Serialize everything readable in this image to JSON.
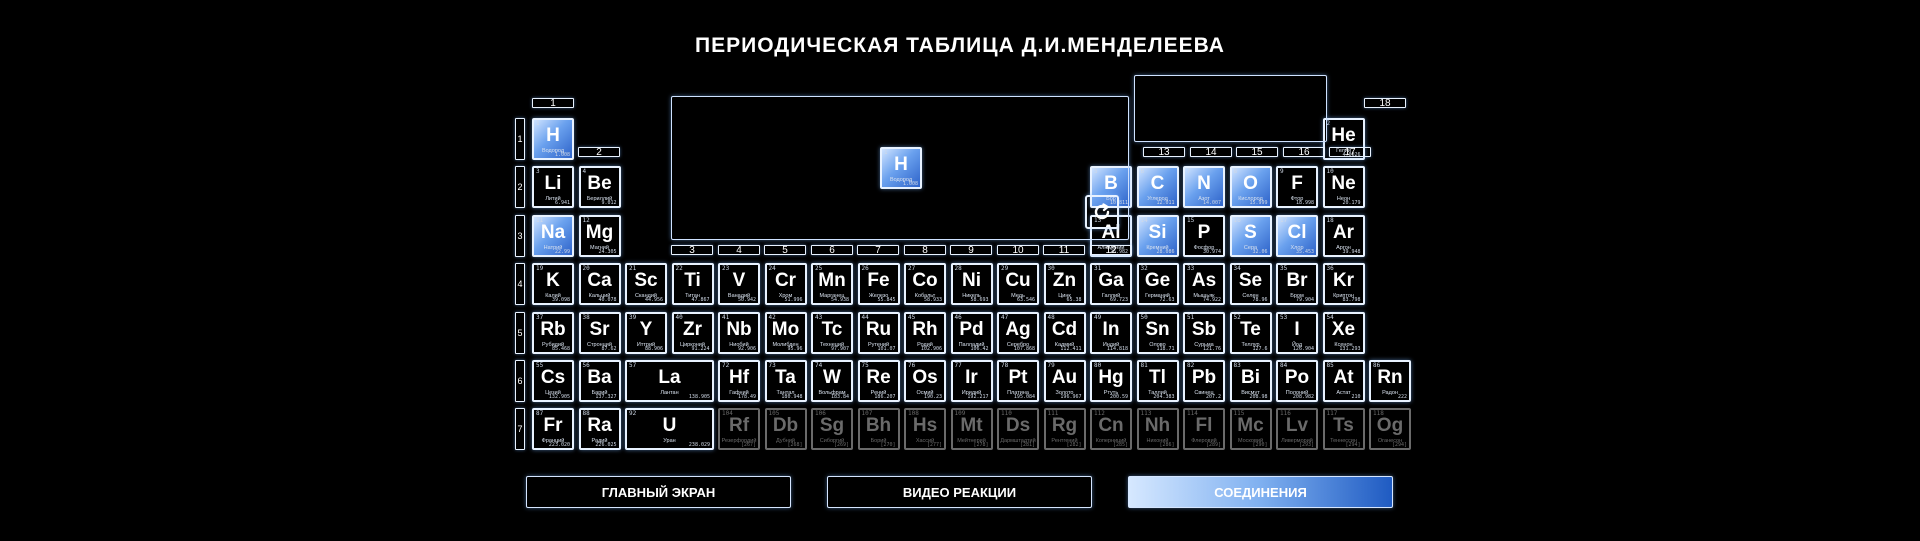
{
  "title": "ПЕРИОДИЧЕСКАЯ ТАБЛИЦА Д.И.МЕНДЕЛЕЕВА",
  "groups": [
    "1",
    "2",
    "3",
    "4",
    "5",
    "6",
    "7",
    "8",
    "9",
    "10",
    "11",
    "12",
    "13",
    "14",
    "15",
    "16",
    "17",
    "18"
  ],
  "periods": [
    "1",
    "2",
    "3",
    "4",
    "5",
    "6",
    "7"
  ],
  "selected": {
    "symbol": "H",
    "name": "Водород",
    "number": "1",
    "mass": "1.008"
  },
  "buttons": {
    "home": "ГЛАВНЫЙ ЭКРАН",
    "video": "ВИДЕО РЕАКЦИИ",
    "compounds": "СОЕДИНЕНИЯ"
  },
  "colors": {
    "accent": "#2e63c9",
    "highlight": "#6aa1ee",
    "border": "#e8f2ff",
    "dim": "#6a6a6a"
  },
  "icons": {
    "reload": "reload-icon"
  },
  "elements": [
    {
      "n": "1",
      "s": "H",
      "name": "Водород",
      "m": "1.008",
      "p": 1,
      "g": 1,
      "hl": true
    },
    {
      "n": "2",
      "s": "He",
      "name": "Гелий",
      "m": "4.0026",
      "p": 1,
      "g": 18
    },
    {
      "n": "3",
      "s": "Li",
      "name": "Литий",
      "m": "6.941",
      "p": 2,
      "g": 1
    },
    {
      "n": "4",
      "s": "Be",
      "name": "Бериллий",
      "m": "9.012",
      "p": 2,
      "g": 2
    },
    {
      "n": "5",
      "s": "B",
      "name": "Бор",
      "m": "10.811",
      "p": 2,
      "g": 13,
      "hl": true
    },
    {
      "n": "6",
      "s": "C",
      "name": "Углерод",
      "m": "12.011",
      "p": 2,
      "g": 14,
      "hl": true
    },
    {
      "n": "7",
      "s": "N",
      "name": "Азот",
      "m": "14.007",
      "p": 2,
      "g": 15,
      "hl": true
    },
    {
      "n": "8",
      "s": "O",
      "name": "Кислород",
      "m": "15.999",
      "p": 2,
      "g": 16,
      "hl": true
    },
    {
      "n": "9",
      "s": "F",
      "name": "Фтор",
      "m": "18.998",
      "p": 2,
      "g": 17
    },
    {
      "n": "10",
      "s": "Ne",
      "name": "Неон",
      "m": "20.179",
      "p": 2,
      "g": 18
    },
    {
      "n": "11",
      "s": "Na",
      "name": "Натрий",
      "m": "22.99",
      "p": 3,
      "g": 1,
      "hl": true
    },
    {
      "n": "12",
      "s": "Mg",
      "name": "Магний",
      "m": "24.305",
      "p": 3,
      "g": 2
    },
    {
      "n": "13",
      "s": "Al",
      "name": "Алюминий",
      "m": "26.982",
      "p": 3,
      "g": 13
    },
    {
      "n": "14",
      "s": "Si",
      "name": "Кремний",
      "m": "28.086",
      "p": 3,
      "g": 14,
      "hl": true
    },
    {
      "n": "15",
      "s": "P",
      "name": "Фосфор",
      "m": "30.974",
      "p": 3,
      "g": 15
    },
    {
      "n": "16",
      "s": "S",
      "name": "Сера",
      "m": "32.06",
      "p": 3,
      "g": 16,
      "hl": true
    },
    {
      "n": "17",
      "s": "Cl",
      "name": "Хлор",
      "m": "35.453",
      "p": 3,
      "g": 17,
      "hl": true
    },
    {
      "n": "18",
      "s": "Ar",
      "name": "Аргон",
      "m": "39.948",
      "p": 3,
      "g": 18
    },
    {
      "n": "19",
      "s": "K",
      "name": "Калий",
      "m": "39.098",
      "p": 4,
      "g": 1
    },
    {
      "n": "20",
      "s": "Ca",
      "name": "Кальций",
      "m": "40.078",
      "p": 4,
      "g": 2
    },
    {
      "n": "21",
      "s": "Sc",
      "name": "Скандий",
      "m": "44.956",
      "p": 4,
      "g": 3
    },
    {
      "n": "22",
      "s": "Ti",
      "name": "Титан",
      "m": "47.867",
      "p": 4,
      "g": 4
    },
    {
      "n": "23",
      "s": "V",
      "name": "Ванадий",
      "m": "50.942",
      "p": 4,
      "g": 5
    },
    {
      "n": "24",
      "s": "Cr",
      "name": "Хром",
      "m": "51.996",
      "p": 4,
      "g": 6
    },
    {
      "n": "25",
      "s": "Mn",
      "name": "Марганец",
      "m": "54.938",
      "p": 4,
      "g": 7
    },
    {
      "n": "26",
      "s": "Fe",
      "name": "Железо",
      "m": "55.845",
      "p": 4,
      "g": 8
    },
    {
      "n": "27",
      "s": "Co",
      "name": "Кобальт",
      "m": "58.933",
      "p": 4,
      "g": 9
    },
    {
      "n": "28",
      "s": "Ni",
      "name": "Никель",
      "m": "58.693",
      "p": 4,
      "g": 10
    },
    {
      "n": "29",
      "s": "Cu",
      "name": "Медь",
      "m": "63.546",
      "p": 4,
      "g": 11
    },
    {
      "n": "30",
      "s": "Zn",
      "name": "Цинк",
      "m": "65.38",
      "p": 4,
      "g": 12
    },
    {
      "n": "31",
      "s": "Ga",
      "name": "Галлий",
      "m": "69.723",
      "p": 4,
      "g": 13
    },
    {
      "n": "32",
      "s": "Ge",
      "name": "Германий",
      "m": "72.63",
      "p": 4,
      "g": 14
    },
    {
      "n": "33",
      "s": "As",
      "name": "Мышьяк",
      "m": "74.922",
      "p": 4,
      "g": 15
    },
    {
      "n": "34",
      "s": "Se",
      "name": "Селен",
      "m": "78.96",
      "p": 4,
      "g": 16
    },
    {
      "n": "35",
      "s": "Br",
      "name": "Бром",
      "m": "79.904",
      "p": 4,
      "g": 17
    },
    {
      "n": "36",
      "s": "Kr",
      "name": "Криптон",
      "m": "83.798",
      "p": 4,
      "g": 18
    },
    {
      "n": "37",
      "s": "Rb",
      "name": "Рубидий",
      "m": "85.468",
      "p": 5,
      "g": 1
    },
    {
      "n": "38",
      "s": "Sr",
      "name": "Стронций",
      "m": "87.62",
      "p": 5,
      "g": 2
    },
    {
      "n": "39",
      "s": "Y",
      "name": "Иттрий",
      "m": "88.906",
      "p": 5,
      "g": 3
    },
    {
      "n": "40",
      "s": "Zr",
      "name": "Цирконий",
      "m": "91.224",
      "p": 5,
      "g": 4
    },
    {
      "n": "41",
      "s": "Nb",
      "name": "Ниобий",
      "m": "92.906",
      "p": 5,
      "g": 5
    },
    {
      "n": "42",
      "s": "Mo",
      "name": "Молибден",
      "m": "95.96",
      "p": 5,
      "g": 6
    },
    {
      "n": "43",
      "s": "Tc",
      "name": "Технеций",
      "m": "97.907",
      "p": 5,
      "g": 7
    },
    {
      "n": "44",
      "s": "Ru",
      "name": "Рутений",
      "m": "101.07",
      "p": 5,
      "g": 8
    },
    {
      "n": "45",
      "s": "Rh",
      "name": "Родий",
      "m": "102.906",
      "p": 5,
      "g": 9
    },
    {
      "n": "46",
      "s": "Pd",
      "name": "Палладий",
      "m": "106.42",
      "p": 5,
      "g": 10
    },
    {
      "n": "47",
      "s": "Ag",
      "name": "Серебро",
      "m": "107.868",
      "p": 5,
      "g": 11
    },
    {
      "n": "48",
      "s": "Cd",
      "name": "Кадмий",
      "m": "112.411",
      "p": 5,
      "g": 12
    },
    {
      "n": "49",
      "s": "In",
      "name": "Индий",
      "m": "114.818",
      "p": 5,
      "g": 13
    },
    {
      "n": "50",
      "s": "Sn",
      "name": "Олово",
      "m": "118.71",
      "p": 5,
      "g": 14
    },
    {
      "n": "51",
      "s": "Sb",
      "name": "Сурьма",
      "m": "121.76",
      "p": 5,
      "g": 15
    },
    {
      "n": "52",
      "s": "Te",
      "name": "Теллур",
      "m": "127.6",
      "p": 5,
      "g": 16
    },
    {
      "n": "53",
      "s": "I",
      "name": "Йод",
      "m": "126.904",
      "p": 5,
      "g": 17
    },
    {
      "n": "54",
      "s": "Xe",
      "name": "Ксенон",
      "m": "131.293",
      "p": 5,
      "g": 18
    },
    {
      "n": "55",
      "s": "Cs",
      "name": "Цезий",
      "m": "132.905",
      "p": 6,
      "g": 1
    },
    {
      "n": "56",
      "s": "Ba",
      "name": "Барий",
      "m": "137.327",
      "p": 6,
      "g": 2
    },
    {
      "n": "57",
      "s": "La",
      "name": "Лантан",
      "m": "138.905",
      "p": 6,
      "g": 3,
      "wide": true
    },
    {
      "n": "72",
      "s": "Hf",
      "name": "Гафний",
      "m": "178.49",
      "p": 6,
      "g": 5
    },
    {
      "n": "73",
      "s": "Ta",
      "name": "Тантал",
      "m": "180.948",
      "p": 6,
      "g": 6
    },
    {
      "n": "74",
      "s": "W",
      "name": "Вольфрам",
      "m": "183.84",
      "p": 6,
      "g": 7
    },
    {
      "n": "75",
      "s": "Re",
      "name": "Рений",
      "m": "186.207",
      "p": 6,
      "g": 8
    },
    {
      "n": "76",
      "s": "Os",
      "name": "Осмий",
      "m": "190.23",
      "p": 6,
      "g": 9
    },
    {
      "n": "77",
      "s": "Ir",
      "name": "Иридий",
      "m": "192.217",
      "p": 6,
      "g": 10
    },
    {
      "n": "78",
      "s": "Pt",
      "name": "Платина",
      "m": "195.084",
      "p": 6,
      "g": 11
    },
    {
      "n": "79",
      "s": "Au",
      "name": "Золото",
      "m": "196.967",
      "p": 6,
      "g": 12
    },
    {
      "n": "80",
      "s": "Hg",
      "name": "Ртуть",
      "m": "200.59",
      "p": 6,
      "g": 13
    },
    {
      "n": "81",
      "s": "Tl",
      "name": "Таллий",
      "m": "204.383",
      "p": 6,
      "g": 14
    },
    {
      "n": "82",
      "s": "Pb",
      "name": "Свинец",
      "m": "207.2",
      "p": 6,
      "g": 15
    },
    {
      "n": "83",
      "s": "Bi",
      "name": "Висмут",
      "m": "208.98",
      "p": 6,
      "g": 16
    },
    {
      "n": "84",
      "s": "Po",
      "name": "Полоний",
      "m": "208.982",
      "p": 6,
      "g": 17
    },
    {
      "n": "85",
      "s": "At",
      "name": "Астат",
      "m": "210",
      "p": 6,
      "g": 18
    },
    {
      "n": "86",
      "s": "Rn",
      "name": "Радон",
      "m": "222",
      "p": 6,
      "g": 19
    },
    {
      "n": "87",
      "s": "Fr",
      "name": "Франций",
      "m": "223.020",
      "p": 7,
      "g": 1
    },
    {
      "n": "88",
      "s": "Ra",
      "name": "Радий",
      "m": "226.025",
      "p": 7,
      "g": 2
    },
    {
      "n": "92",
      "s": "U",
      "name": "Уран",
      "m": "238.029",
      "p": 7,
      "g": 3,
      "wide": true
    },
    {
      "n": "104",
      "s": "Rf",
      "name": "Резерфордий",
      "m": "[267]",
      "p": 7,
      "g": 5,
      "dim": true
    },
    {
      "n": "105",
      "s": "Db",
      "name": "Дубний",
      "m": "[268]",
      "p": 7,
      "g": 6,
      "dim": true
    },
    {
      "n": "106",
      "s": "Sg",
      "name": "Сиборгий",
      "m": "[269]",
      "p": 7,
      "g": 7,
      "dim": true
    },
    {
      "n": "107",
      "s": "Bh",
      "name": "Борий",
      "m": "[270]",
      "p": 7,
      "g": 8,
      "dim": true
    },
    {
      "n": "108",
      "s": "Hs",
      "name": "Хассий",
      "m": "[277]",
      "p": 7,
      "g": 9,
      "dim": true
    },
    {
      "n": "109",
      "s": "Mt",
      "name": "Мейтнерий",
      "m": "[278]",
      "p": 7,
      "g": 10,
      "dim": true
    },
    {
      "n": "110",
      "s": "Ds",
      "name": "Дармштадтий",
      "m": "[281]",
      "p": 7,
      "g": 11,
      "dim": true
    },
    {
      "n": "111",
      "s": "Rg",
      "name": "Рентгений",
      "m": "[282]",
      "p": 7,
      "g": 12,
      "dim": true
    },
    {
      "n": "112",
      "s": "Cn",
      "name": "Коперниций",
      "m": "[285]",
      "p": 7,
      "g": 13,
      "dim": true
    },
    {
      "n": "113",
      "s": "Nh",
      "name": "Нихоний",
      "m": "[286]",
      "p": 7,
      "g": 14,
      "dim": true
    },
    {
      "n": "114",
      "s": "Fl",
      "name": "Флеровий",
      "m": "[289]",
      "p": 7,
      "g": 15,
      "dim": true
    },
    {
      "n": "115",
      "s": "Mc",
      "name": "Московий",
      "m": "[290]",
      "p": 7,
      "g": 16,
      "dim": true
    },
    {
      "n": "116",
      "s": "Lv",
      "name": "Ливерморий",
      "m": "[293]",
      "p": 7,
      "g": 17,
      "dim": true
    },
    {
      "n": "117",
      "s": "Ts",
      "name": "Теннессин",
      "m": "[294]",
      "p": 7,
      "g": 18,
      "dim": true
    },
    {
      "n": "118",
      "s": "Og",
      "name": "Оганесон",
      "m": "[294]",
      "p": 7,
      "g": 19,
      "dim": true
    }
  ]
}
